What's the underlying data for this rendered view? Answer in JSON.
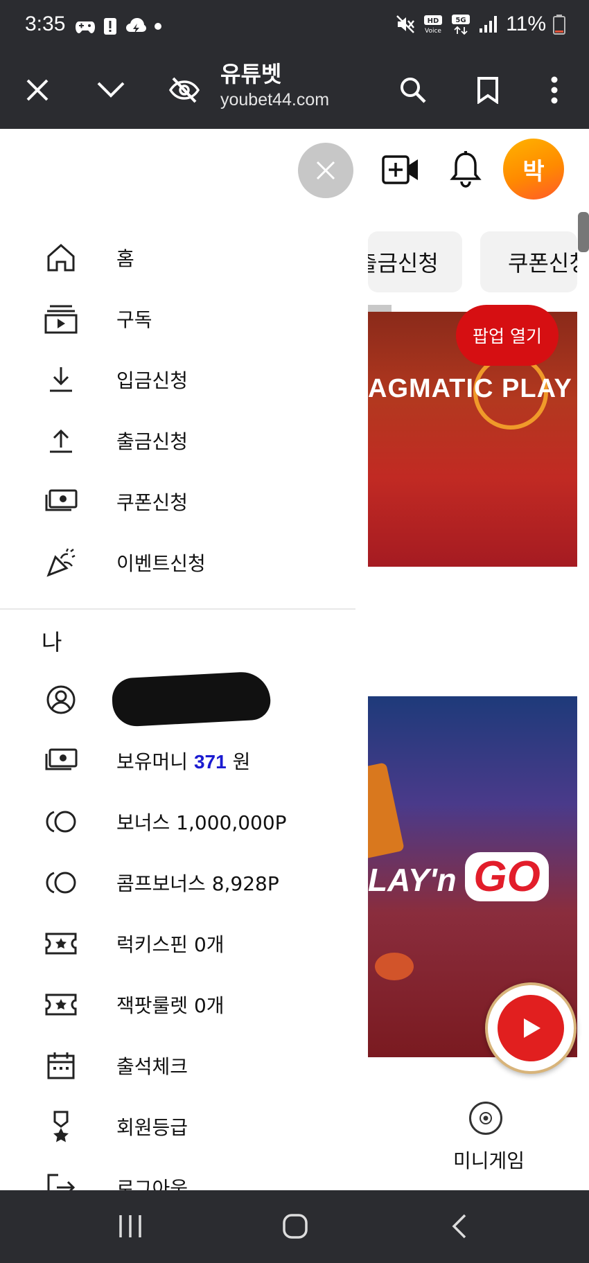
{
  "status_bar": {
    "time": "3:35",
    "battery": "11%"
  },
  "browser": {
    "site_title": "유튜벳",
    "site_url": "youbet44.com"
  },
  "header": {
    "avatar_initial": "박"
  },
  "background": {
    "chips": [
      "출금신청",
      "쿠폰신청"
    ],
    "banner_1_logo": "AGMATIC PLAY",
    "banner_2_logo_prefix": "LAY'n",
    "banner_2_logo_go": "GO",
    "popup_button": "팝업 열기",
    "mini_game_label": "미니게임"
  },
  "drawer": {
    "menu": [
      {
        "label": "홈",
        "icon": "home-icon"
      },
      {
        "label": "구독",
        "icon": "subscriptions-icon"
      },
      {
        "label": "입금신청",
        "icon": "download-icon"
      },
      {
        "label": "출금신청",
        "icon": "upload-icon"
      },
      {
        "label": "쿠폰신청",
        "icon": "money-icon"
      },
      {
        "label": "이벤트신청",
        "icon": "party-popper-icon"
      }
    ],
    "section_title": "나",
    "me": {
      "money_prefix": "보유머니 ",
      "money_amount": "371",
      "money_suffix": " 원",
      "bonus": "보너스 1,000,000P",
      "comp_bonus": "콤프보너스 8,928P",
      "lucky_spin": "럭키스핀 0개",
      "jackpot_roulette": "잭팟룰렛 0개",
      "attendance": "출석체크",
      "member_grade": "회원등급",
      "logout": "로그아웃"
    }
  },
  "colors": {
    "system_bar": "#2b2c30",
    "accent_amount": "#1b1bd0",
    "popup_red": "#d60f12"
  }
}
